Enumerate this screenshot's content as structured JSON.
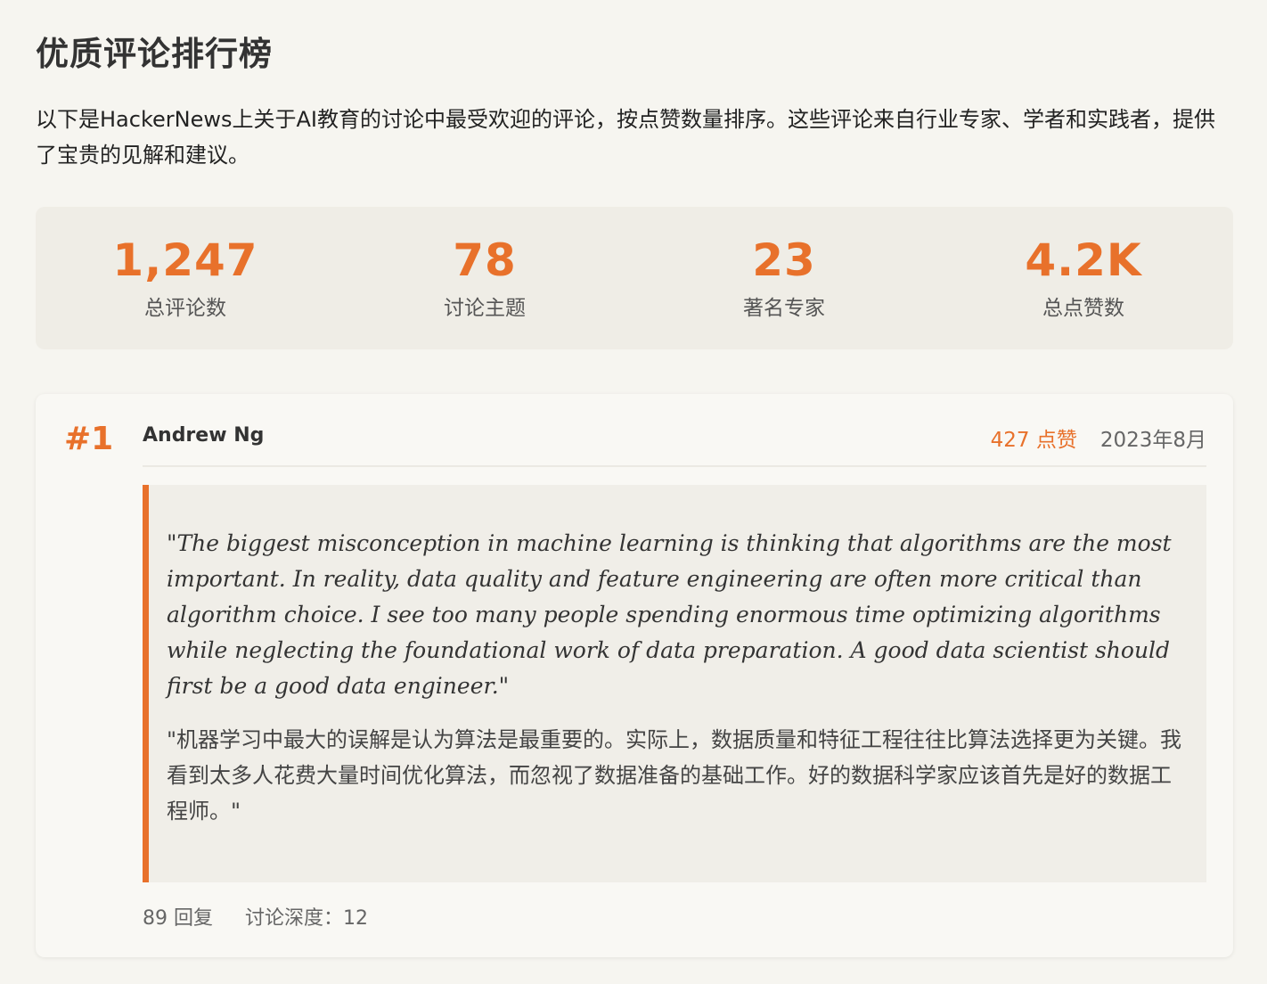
{
  "page_title": "优质评论排行榜",
  "intro": "以下是HackerNews上关于AI教育的讨论中最受欢迎的评论，按点赞数量排序。这些评论来自行业专家、学者和实践者，提供了宝贵的见解和建议。",
  "stats": [
    {
      "value": "1,247",
      "label": "总评论数"
    },
    {
      "value": "78",
      "label": "讨论主题"
    },
    {
      "value": "23",
      "label": "著名专家"
    },
    {
      "value": "4.2K",
      "label": "总点赞数"
    }
  ],
  "comments": [
    {
      "rank": "#1",
      "author": "Andrew Ng",
      "likes": "427 点赞",
      "date": "2023年8月",
      "quote_en": "\"The biggest misconception in machine learning is thinking that algorithms are the most important. In reality, data quality and feature engineering are often more critical than algorithm choice. I see too many people spending enormous time optimizing algorithms while neglecting the foundational work of data preparation. A good data scientist should first be a good data engineer.\"",
      "quote_zh": "\"机器学习中最大的误解是认为算法是最重要的。实际上，数据质量和特征工程往往比算法选择更为关键。我看到太多人花费大量时间优化算法，而忽视了数据准备的基础工作。好的数据科学家应该首先是好的数据工程师。\"",
      "replies": "89 回复",
      "depth": "讨论深度：12"
    }
  ],
  "colors": {
    "accent": "#e8712b",
    "background": "#f6f5f0",
    "stats_bg": "#efede6",
    "quote_bg": "#f0eee8"
  }
}
